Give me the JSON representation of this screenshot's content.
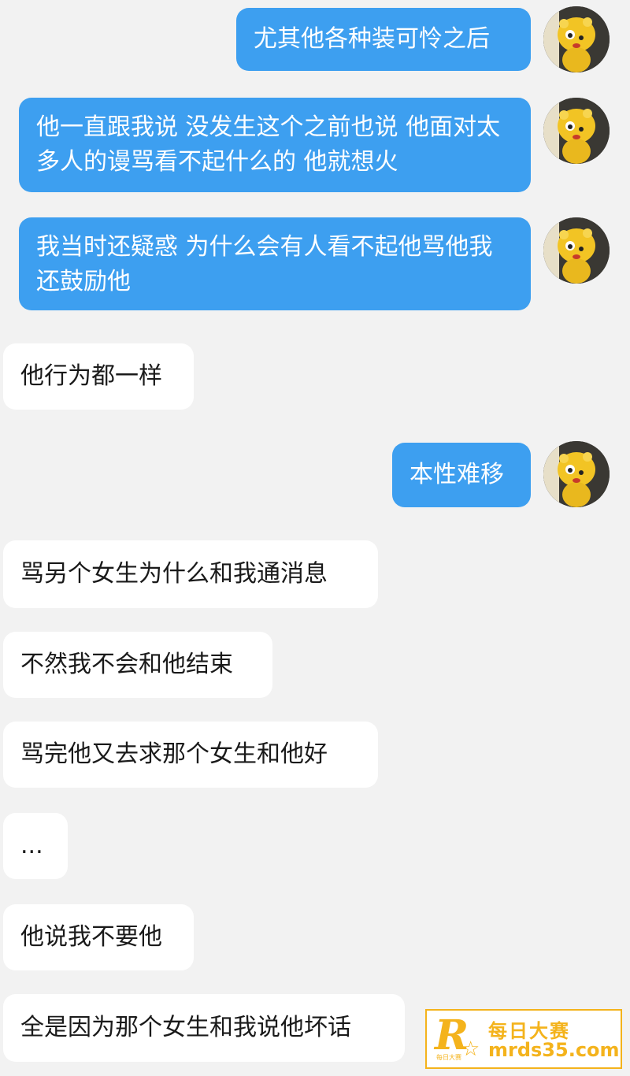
{
  "messages": [
    {
      "direction": "sent",
      "text": "尤其他各种装可怜之后"
    },
    {
      "direction": "sent",
      "text": "他一直跟我说 没发生这个之前也说 他面对太多人的谩骂看不起什么的 他就想火"
    },
    {
      "direction": "sent",
      "text": "我当时还疑惑 为什么会有人看不起他骂他我还鼓励他"
    },
    {
      "direction": "received",
      "text": "他行为都一样"
    },
    {
      "direction": "sent",
      "text": "本性难移"
    },
    {
      "direction": "received",
      "text": "骂另个女生为什么和我通消息"
    },
    {
      "direction": "received",
      "text": "不然我不会和他结束"
    },
    {
      "direction": "received",
      "text": "骂完他又去求那个女生和他好"
    },
    {
      "direction": "received",
      "text": "..."
    },
    {
      "direction": "received",
      "text": "他说我不要他"
    },
    {
      "direction": "received",
      "text": "全是因为那个女生和我说他坏话"
    }
  ],
  "avatar": {
    "icon": "cartoon-character-avatar-icon"
  },
  "watermark": {
    "logo_letter": "R",
    "logo_caption": "每日大赛",
    "title": "每日大赛",
    "url": "mrds35.com"
  },
  "colors": {
    "background": "#f2f2f2",
    "sent_bubble": "#3d9ff0",
    "received_bubble": "#ffffff",
    "watermark": "#f4b31c"
  }
}
